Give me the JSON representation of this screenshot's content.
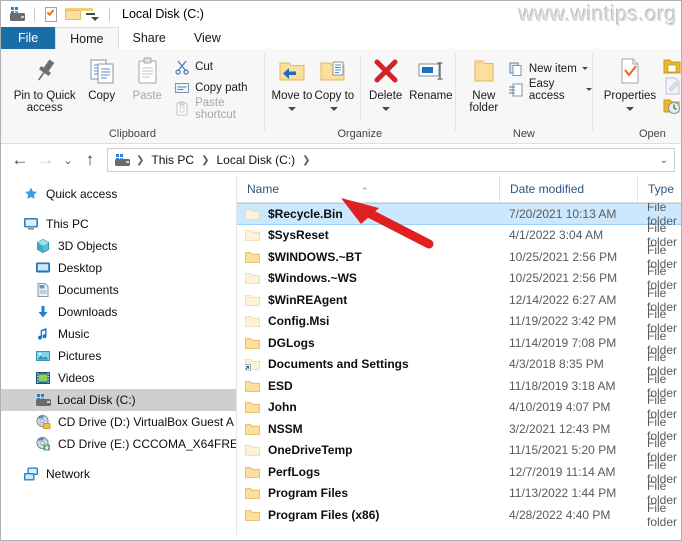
{
  "window": {
    "title": "Local Disk (C:)",
    "watermark": "www.wintips.org",
    "quick_access_icons": [
      "drive-icon",
      "properties-checkbox-icon",
      "new-folder-icon",
      "customize-qat-chevron-icon"
    ]
  },
  "ribbon": {
    "tabs": [
      {
        "label": "File",
        "state": "file"
      },
      {
        "label": "Home",
        "state": "active"
      },
      {
        "label": "Share",
        "state": "normal"
      },
      {
        "label": "View",
        "state": "normal"
      }
    ],
    "groups": [
      {
        "name": "Clipboard",
        "big_buttons": [
          {
            "label": "Pin to Quick access",
            "icon": "pin-icon",
            "disabled": false
          },
          {
            "label": "Copy",
            "icon": "copy-icon",
            "disabled": false
          },
          {
            "label": "Paste",
            "icon": "paste-icon",
            "disabled": true
          }
        ],
        "small_buttons": [
          {
            "label": "Cut",
            "icon": "scissors-icon",
            "disabled": false
          },
          {
            "label": "Copy path",
            "icon": "copy-path-icon",
            "disabled": false
          },
          {
            "label": "Paste shortcut",
            "icon": "paste-shortcut-icon",
            "disabled": true
          }
        ]
      },
      {
        "name": "Organize",
        "big_buttons": [
          {
            "label": "Move to",
            "icon": "move-to-icon",
            "has_dropdown": true
          },
          {
            "label": "Copy to",
            "icon": "copy-to-icon",
            "has_dropdown": true
          },
          {
            "label": "Delete",
            "icon": "delete-x-icon",
            "has_dropdown": true
          },
          {
            "label": "Rename",
            "icon": "rename-icon",
            "has_dropdown": false
          }
        ]
      },
      {
        "name": "New",
        "big_buttons": [
          {
            "label": "New folder",
            "icon": "new-folder-icon",
            "has_dropdown": false
          }
        ],
        "small_buttons": [
          {
            "label": "New item",
            "icon": "new-item-icon",
            "has_dropdown": true
          },
          {
            "label": "Easy access",
            "icon": "easy-access-icon",
            "has_dropdown": true
          }
        ]
      },
      {
        "name": "Open",
        "big_buttons": [
          {
            "label": "Properties",
            "icon": "properties-icon",
            "has_dropdown": true
          }
        ],
        "small_buttons": [
          {
            "label": "",
            "icon": "open-folder-icon",
            "disabled": false
          },
          {
            "label": "",
            "icon": "edit-icon",
            "disabled": true
          },
          {
            "label": "",
            "icon": "history-icon",
            "disabled": false
          }
        ]
      }
    ]
  },
  "address_bar": {
    "back_icon": "back-arrow-icon",
    "forward_icon": "forward-arrow-icon",
    "recent_icon": "recent-locations-chevron-icon",
    "up_icon": "up-arrow-icon",
    "root_icon": "drive-icon",
    "crumbs": [
      "This PC",
      "Local Disk (C:)"
    ],
    "dropdown_icon": "chevron-down-icon"
  },
  "nav_pane": {
    "items": [
      {
        "label": "Quick access",
        "icon": "star-pin-icon",
        "indent": false,
        "selected": false
      },
      {
        "label": "This PC",
        "icon": "this-pc-icon",
        "indent": false,
        "selected": false,
        "gap_before": true
      },
      {
        "label": "3D Objects",
        "icon": "3d-objects-icon",
        "indent": true,
        "selected": false
      },
      {
        "label": "Desktop",
        "icon": "desktop-icon",
        "indent": true,
        "selected": false
      },
      {
        "label": "Documents",
        "icon": "documents-icon",
        "indent": true,
        "selected": false
      },
      {
        "label": "Downloads",
        "icon": "downloads-icon",
        "indent": true,
        "selected": false
      },
      {
        "label": "Music",
        "icon": "music-icon",
        "indent": true,
        "selected": false
      },
      {
        "label": "Pictures",
        "icon": "pictures-icon",
        "indent": true,
        "selected": false
      },
      {
        "label": "Videos",
        "icon": "videos-icon",
        "indent": true,
        "selected": false
      },
      {
        "label": "Local Disk (C:)",
        "icon": "drive-icon",
        "indent": true,
        "selected": true
      },
      {
        "label": "CD Drive (D:) VirtualBox Guest A",
        "icon": "cd-drive-icon",
        "indent": true,
        "selected": false
      },
      {
        "label": "CD Drive (E:) CCCOMA_X64FRE_",
        "icon": "cd-drive-icon",
        "indent": true,
        "selected": false
      },
      {
        "label": "Network",
        "icon": "network-icon",
        "indent": false,
        "selected": false,
        "gap_before": true
      }
    ]
  },
  "file_list": {
    "columns": [
      "Name",
      "Date modified",
      "Type"
    ],
    "sort_column": "Name",
    "sort_direction": "ascending",
    "rows": [
      {
        "name": "$Recycle.Bin",
        "date": "7/20/2021 10:13 AM",
        "type": "File folder",
        "icon": "folder-hidden-icon",
        "selected": true
      },
      {
        "name": "$SysReset",
        "date": "4/1/2022 3:04 AM",
        "type": "File folder",
        "icon": "folder-hidden-icon",
        "selected": false
      },
      {
        "name": "$WINDOWS.~BT",
        "date": "10/25/2021 2:56 PM",
        "type": "File folder",
        "icon": "folder-icon",
        "selected": false
      },
      {
        "name": "$Windows.~WS",
        "date": "10/25/2021 2:56 PM",
        "type": "File folder",
        "icon": "folder-hidden-icon",
        "selected": false
      },
      {
        "name": "$WinREAgent",
        "date": "12/14/2022 6:27 AM",
        "type": "File folder",
        "icon": "folder-hidden-icon",
        "selected": false
      },
      {
        "name": "Config.Msi",
        "date": "11/19/2022 3:42 PM",
        "type": "File folder",
        "icon": "folder-hidden-icon",
        "selected": false
      },
      {
        "name": "DGLogs",
        "date": "11/14/2019 7:08 PM",
        "type": "File folder",
        "icon": "folder-icon",
        "selected": false
      },
      {
        "name": "Documents and Settings",
        "date": "4/3/2018 8:35 PM",
        "type": "File folder",
        "icon": "folder-shortcut-icon",
        "selected": false
      },
      {
        "name": "ESD",
        "date": "11/18/2019 3:18 AM",
        "type": "File folder",
        "icon": "folder-icon",
        "selected": false
      },
      {
        "name": "John",
        "date": "4/10/2019 4:07 PM",
        "type": "File folder",
        "icon": "folder-icon",
        "selected": false
      },
      {
        "name": "NSSM",
        "date": "3/2/2021 12:43 PM",
        "type": "File folder",
        "icon": "folder-icon",
        "selected": false
      },
      {
        "name": "OneDriveTemp",
        "date": "11/15/2021 5:20 PM",
        "type": "File folder",
        "icon": "folder-hidden-icon",
        "selected": false
      },
      {
        "name": "PerfLogs",
        "date": "12/7/2019 11:14 AM",
        "type": "File folder",
        "icon": "folder-icon",
        "selected": false
      },
      {
        "name": "Program Files",
        "date": "11/13/2022 1:44 PM",
        "type": "File folder",
        "icon": "folder-icon",
        "selected": false
      },
      {
        "name": "Program Files (x86)",
        "date": "4/28/2022 4:40 PM",
        "type": "File folder",
        "icon": "folder-icon",
        "selected": false
      }
    ]
  },
  "annotation": {
    "arrow_color": "#e02020",
    "points_at": "$Recycle.Bin"
  }
}
